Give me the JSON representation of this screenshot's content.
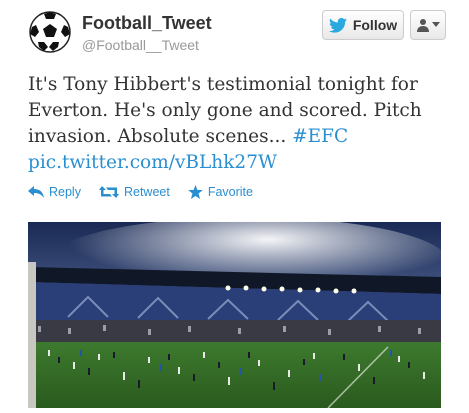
{
  "user": {
    "name": "Football_Tweet",
    "handle": "@Football__Tweet"
  },
  "buttons": {
    "follow_label": "Follow"
  },
  "tweet": {
    "line1": "It's Tony Hibbert's testimonial tonight for",
    "line2": "Everton. He's only gone and scored. Pitch",
    "line3_text": "invasion. Absolute scenes... ",
    "hashtag": "#EFC",
    "link": "pic.twitter.com/vBLhk27W"
  },
  "actions": {
    "reply": "Reply",
    "retweet": "Retweet",
    "favorite": "Favorite"
  },
  "colors": {
    "link": "#2a8fd1",
    "twitter_bird": "#2aa9e0"
  }
}
